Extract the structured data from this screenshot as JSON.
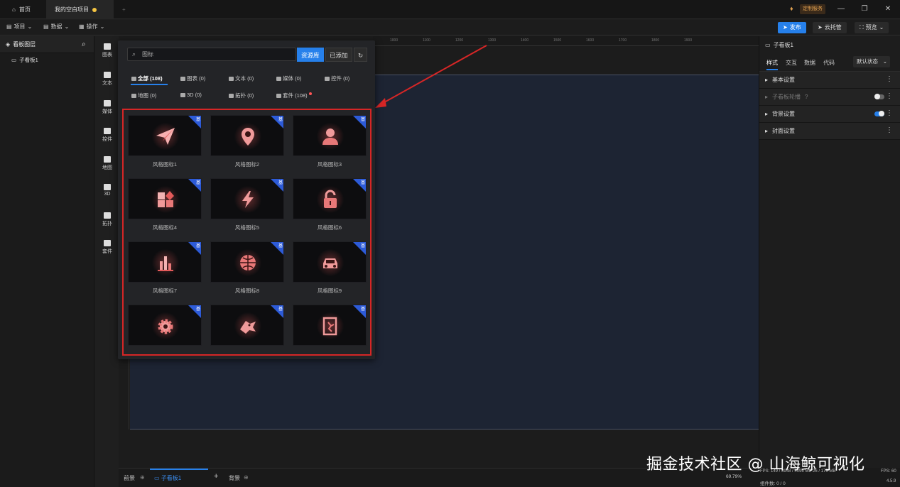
{
  "titlebar": {
    "tabs": [
      {
        "label": "首页"
      },
      {
        "label": "我的空白项目"
      }
    ],
    "new_tab": "+",
    "custom_service": "定制服务"
  },
  "toolbar": {
    "menus": [
      {
        "label": "项目"
      },
      {
        "label": "数据"
      },
      {
        "label": "操作"
      }
    ],
    "publish": "发布",
    "cloud": "云托管",
    "preview": "预览"
  },
  "layers": {
    "title": "看板图层",
    "items": [
      {
        "label": "子看板1"
      }
    ]
  },
  "rail": {
    "items": [
      {
        "label": "图表"
      },
      {
        "label": "文本"
      },
      {
        "label": "媒体"
      },
      {
        "label": "控件"
      },
      {
        "label": "地图"
      },
      {
        "label": "3D"
      },
      {
        "label": "拓扑"
      },
      {
        "label": "套件"
      }
    ]
  },
  "popup": {
    "search_value": "图标",
    "seg": {
      "library": "资源库",
      "added": "已添加"
    },
    "categories": [
      {
        "label": "全部 (108)"
      },
      {
        "label": "图表 (0)"
      },
      {
        "label": "文本 (0)"
      },
      {
        "label": "媒体 (0)"
      },
      {
        "label": "控件 (0)"
      },
      {
        "label": "地图 (0)"
      },
      {
        "label": "3D (0)"
      },
      {
        "label": "拓扑 (0)"
      },
      {
        "label": "套件 (108)"
      }
    ],
    "card_tag": "基",
    "cards": [
      {
        "label": "风格图标1",
        "icon": "paper-plane-icon"
      },
      {
        "label": "风格图标2",
        "icon": "location-pin-icon"
      },
      {
        "label": "风格图标3",
        "icon": "user-icon"
      },
      {
        "label": "风格图标4",
        "icon": "apps-grid-icon"
      },
      {
        "label": "风格图标5",
        "icon": "lightning-icon"
      },
      {
        "label": "风格图标6",
        "icon": "unlock-icon"
      },
      {
        "label": "风格图标7",
        "icon": "bar-chart-icon"
      },
      {
        "label": "风格图标8",
        "icon": "globe-icon"
      },
      {
        "label": "风格图标9",
        "icon": "car-icon"
      },
      {
        "label": "",
        "icon": "gear-icon"
      },
      {
        "label": "",
        "icon": "dragon-icon"
      },
      {
        "label": "",
        "icon": "exit-door-icon"
      }
    ]
  },
  "ruler_ticks": [
    "1000",
    "1100",
    "1200",
    "1300",
    "1400",
    "1500",
    "1600",
    "1700",
    "1800",
    "1900"
  ],
  "bottom": {
    "foreground": "前景",
    "sub_board": "子看板1",
    "add": "+",
    "background": "背景",
    "zoom": "69.79%"
  },
  "status": {
    "stats": "FPS: 149 / 3948 / 4096 MB 26 / 175 MB",
    "fps": "FPS: 60",
    "version": "4.5.9",
    "components": "组件数: 0 / 0"
  },
  "rightpanel": {
    "title": "子看板1",
    "tabs": [
      {
        "label": "样式"
      },
      {
        "label": "交互"
      },
      {
        "label": "数据"
      },
      {
        "label": "代码"
      }
    ],
    "state": "默认状态",
    "sections": [
      {
        "label": "基本设置"
      },
      {
        "label": "子看板轮播"
      },
      {
        "label": "背景设置"
      },
      {
        "label": "封面设置"
      }
    ]
  },
  "watermark": "掘金技术社区 @ 山海鲸可视化"
}
